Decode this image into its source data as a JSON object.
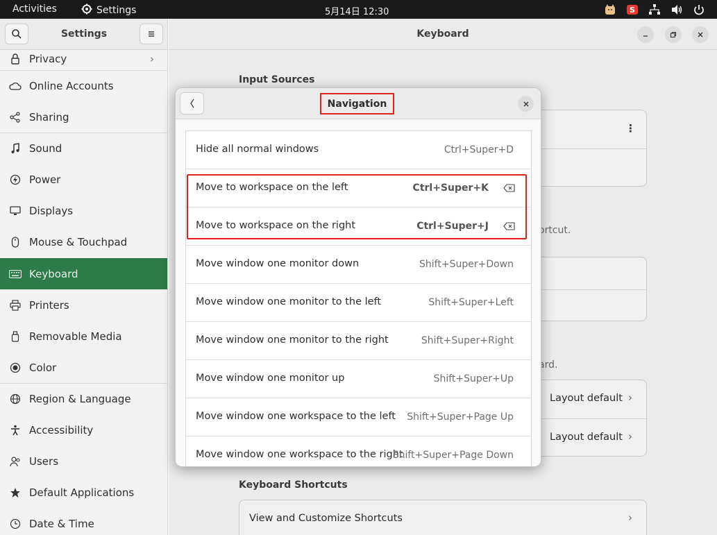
{
  "topbar": {
    "activities": "Activities",
    "app_name": "Settings",
    "clock": "5月14日  12:30"
  },
  "sidebar": {
    "title": "Settings",
    "items": [
      {
        "label": "Privacy",
        "icon": "lock-icon"
      },
      {
        "label": "Online Accounts",
        "icon": "cloud-icon"
      },
      {
        "label": "Sharing",
        "icon": "share-icon"
      },
      {
        "label": "Sound",
        "icon": "music-note-icon"
      },
      {
        "label": "Power",
        "icon": "power-icon"
      },
      {
        "label": "Displays",
        "icon": "display-icon"
      },
      {
        "label": "Mouse & Touchpad",
        "icon": "mouse-icon"
      },
      {
        "label": "Keyboard",
        "icon": "keyboard-icon",
        "active": true
      },
      {
        "label": "Printers",
        "icon": "printer-icon"
      },
      {
        "label": "Removable Media",
        "icon": "usb-drive-icon"
      },
      {
        "label": "Color",
        "icon": "color-icon"
      },
      {
        "label": "Region & Language",
        "icon": "globe-icon"
      },
      {
        "label": "Accessibility",
        "icon": "accessibility-icon"
      },
      {
        "label": "Users",
        "icon": "users-icon"
      },
      {
        "label": "Default Applications",
        "icon": "star-icon"
      },
      {
        "label": "Date & Time",
        "icon": "clock-icon"
      }
    ]
  },
  "main": {
    "title": "Keyboard",
    "input_sources_title": "Input Sources",
    "hint_fragment_1": "ortcut.",
    "hint_fragment_2": "ard.",
    "layout_rows": [
      "Layout default",
      "Layout default"
    ],
    "shortcuts_title": "Keyboard Shortcuts",
    "shortcuts_row": "View and Customize Shortcuts"
  },
  "dialog": {
    "title": "Navigation",
    "rows": [
      {
        "name": "Hide all normal windows",
        "accel": "Ctrl+Super+D"
      },
      {
        "name": "Move to workspace on the left",
        "accel": "Ctrl+Super+K",
        "custom": true
      },
      {
        "name": "Move to workspace on the right",
        "accel": "Ctrl+Super+J",
        "custom": true
      },
      {
        "name": "Move window one monitor down",
        "accel": "Shift+Super+Down"
      },
      {
        "name": "Move window one monitor to the left",
        "accel": "Shift+Super+Left"
      },
      {
        "name": "Move window one monitor to the right",
        "accel": "Shift+Super+Right"
      },
      {
        "name": "Move window one monitor up",
        "accel": "Shift+Super+Up"
      },
      {
        "name": "Move window one workspace to the left",
        "accel": "Shift+Super+Page Up"
      },
      {
        "name": "Move window one workspace to the right",
        "accel": "Shift+Super+Page Down"
      }
    ]
  },
  "colors": {
    "accent": "#2d7a4a",
    "highlight": "#e0221f"
  }
}
